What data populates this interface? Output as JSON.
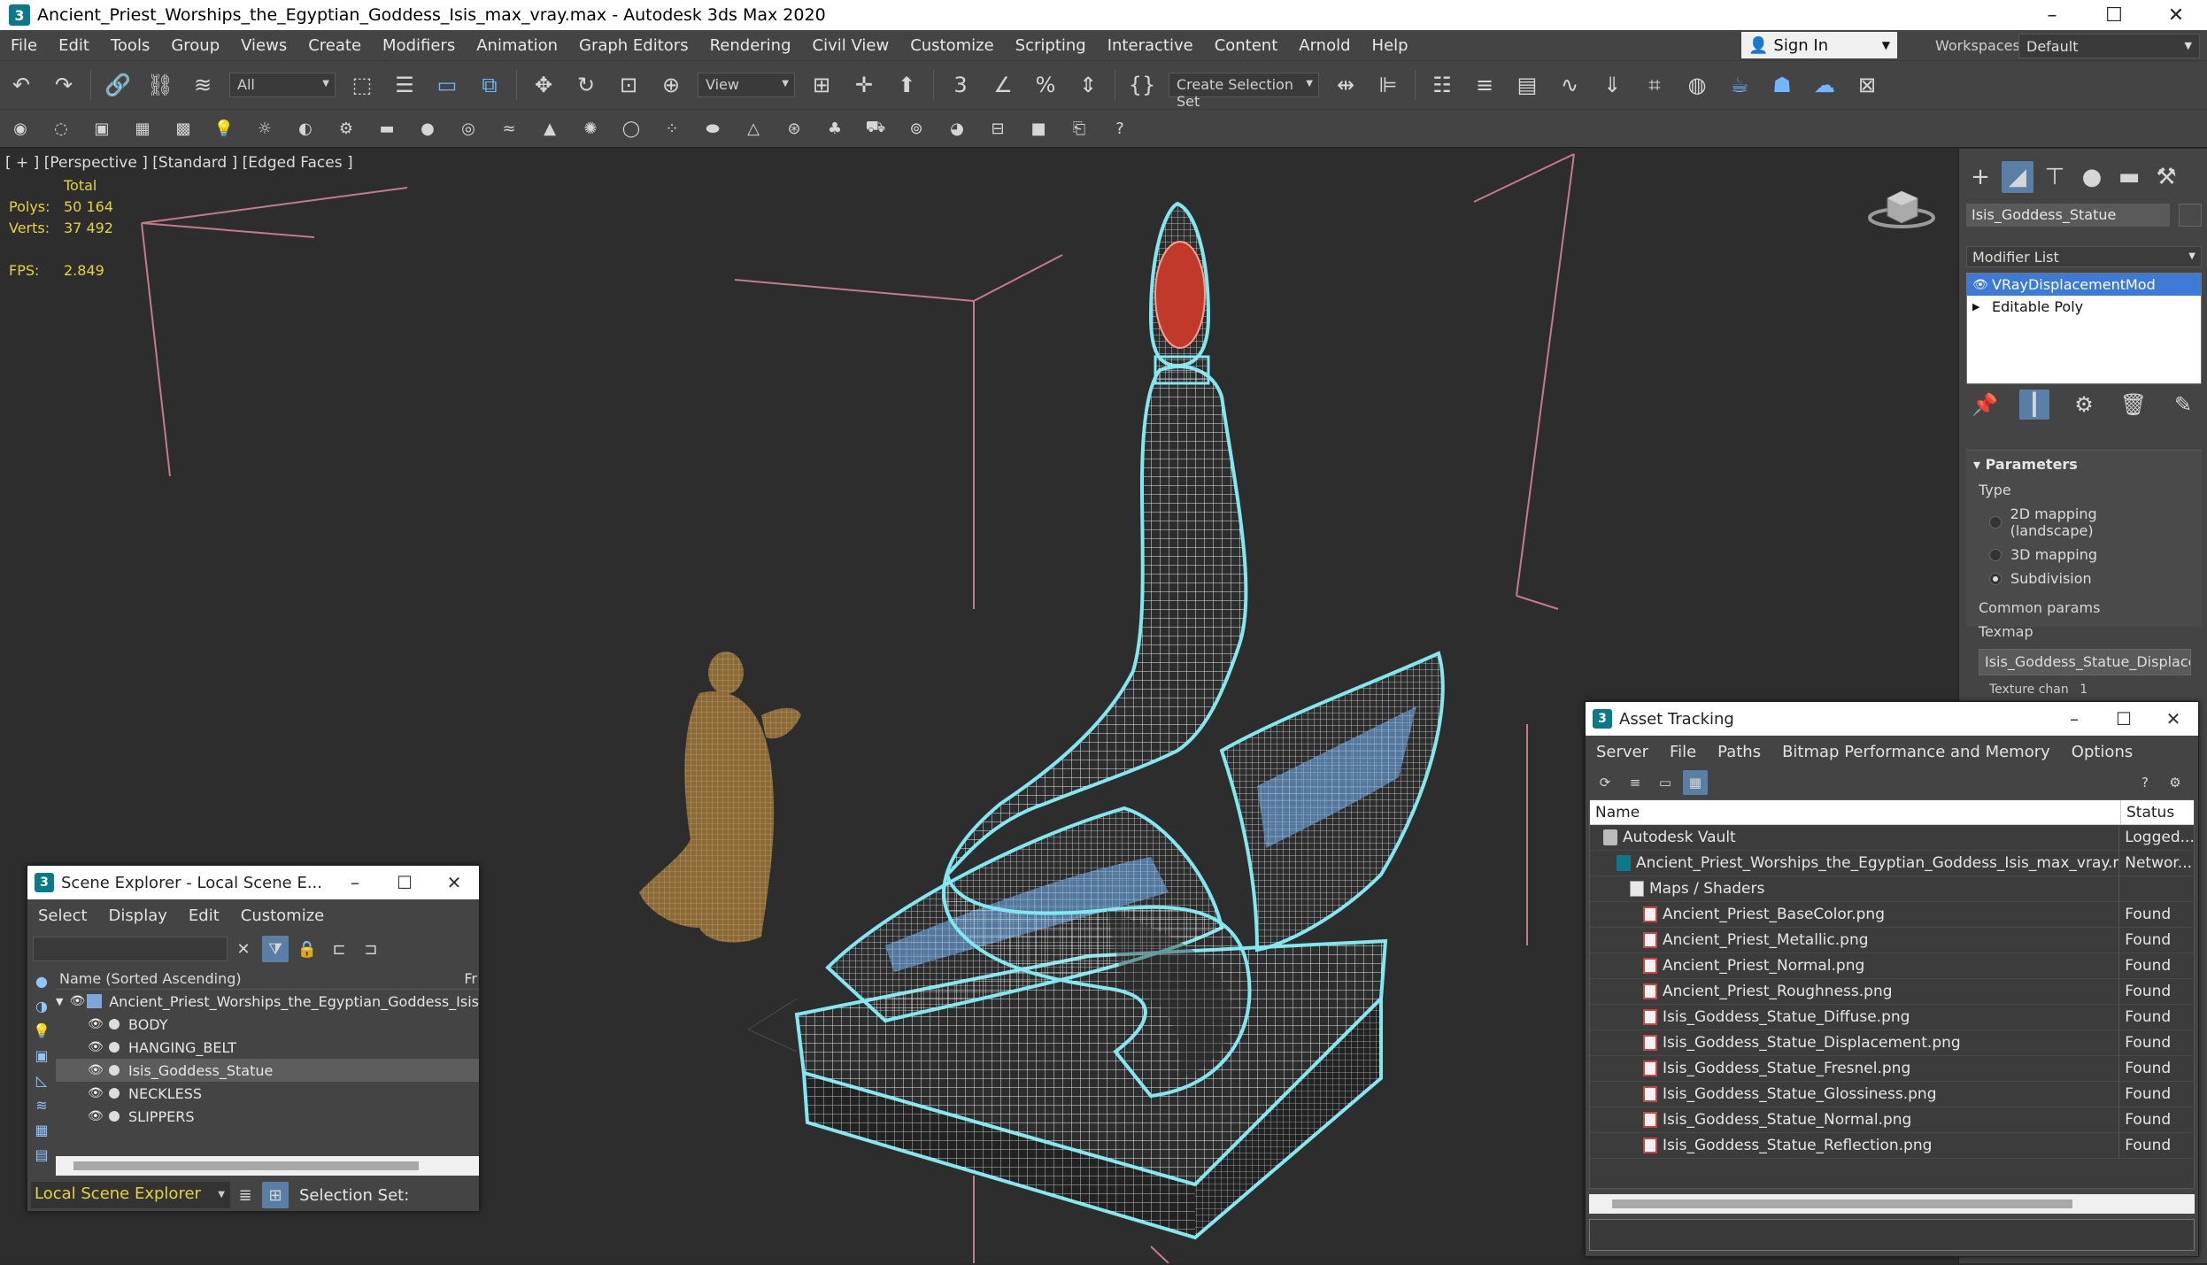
{
  "window": {
    "title": "Ancient_Priest_Worships_the_Egyptian_Goddess_Isis_max_vray.max - Autodesk 3ds Max 2020",
    "app_icon": "3"
  },
  "menu": [
    "File",
    "Edit",
    "Tools",
    "Group",
    "Views",
    "Create",
    "Modifiers",
    "Animation",
    "Graph Editors",
    "Rendering",
    "Civil View",
    "Customize",
    "Scripting",
    "Interactive",
    "Content",
    "Arnold",
    "Help"
  ],
  "signin": {
    "label": "Sign In"
  },
  "workspaces": {
    "label": "Workspaces:",
    "value": "Default"
  },
  "toolbar": {
    "filter_value": "All",
    "refcoord_value": "View",
    "selection_set_placeholder": "Create Selection Set"
  },
  "viewport": {
    "label": "[ + ] [Perspective ] [Standard ] [Edged Faces ]",
    "stats": {
      "total_label": "Total",
      "polys_label": "Polys:",
      "polys_value": "50 164",
      "verts_label": "Verts:",
      "verts_value": "37 492",
      "fps_label": "FPS:",
      "fps_value": "2.849"
    }
  },
  "command_panel": {
    "object_name": "Isis_Goddess_Statue",
    "modifier_list_label": "Modifier List",
    "stack": [
      {
        "label": "VRayDisplacementMod",
        "selected": true
      },
      {
        "label": "Editable Poly",
        "selected": false
      }
    ],
    "params_title": "Parameters",
    "type_label": "Type",
    "type_options": [
      {
        "label": "2D mapping (landscape)",
        "checked": false
      },
      {
        "label": "3D mapping",
        "checked": false
      },
      {
        "label": "Subdivision",
        "checked": true
      }
    ],
    "common_params_label": "Common params",
    "texmap_label": "Texmap",
    "texmap_value": "Isis_Goddess_Statue_Displace",
    "texture_chan_label": "Texture chan",
    "texture_chan_value": "1"
  },
  "scene_explorer": {
    "title": "Scene Explorer - Local Scene E...",
    "menu": [
      "Select",
      "Display",
      "Edit",
      "Customize"
    ],
    "column_header": "Name (Sorted Ascending)",
    "column_header_right": "Fr",
    "root": "Ancient_Priest_Worships_the_Egyptian_Goddess_Isis",
    "items": [
      {
        "label": "BODY",
        "selected": false
      },
      {
        "label": "HANGING_BELT",
        "selected": false
      },
      {
        "label": "Isis_Goddess_Statue",
        "selected": true
      },
      {
        "label": "NECKLESS",
        "selected": false
      },
      {
        "label": "SLIPPERS",
        "selected": false
      }
    ],
    "explorer_selector": "Local Scene Explorer",
    "selection_set_label": "Selection Set:"
  },
  "asset_tracking": {
    "title": "Asset Tracking",
    "menu": [
      "Server",
      "File",
      "Paths",
      "Bitmap Performance and Memory",
      "Options"
    ],
    "columns": {
      "name": "Name",
      "status": "Status"
    },
    "rows": [
      {
        "name": "Autodesk Vault",
        "status": "Logged...",
        "icon": "vault",
        "indent": 1
      },
      {
        "name": "Ancient_Priest_Worships_the_Egyptian_Goddess_Isis_max_vray.max",
        "status": "Networ...",
        "icon": "max",
        "indent": 2
      },
      {
        "name": "Maps / Shaders",
        "status": "",
        "icon": "folder",
        "indent": 3
      },
      {
        "name": "Ancient_Priest_BaseColor.png",
        "status": "Found",
        "icon": "png",
        "indent": 4
      },
      {
        "name": "Ancient_Priest_Metallic.png",
        "status": "Found",
        "icon": "png",
        "indent": 4
      },
      {
        "name": "Ancient_Priest_Normal.png",
        "status": "Found",
        "icon": "png",
        "indent": 4
      },
      {
        "name": "Ancient_Priest_Roughness.png",
        "status": "Found",
        "icon": "png",
        "indent": 4
      },
      {
        "name": "Isis_Goddess_Statue_Diffuse.png",
        "status": "Found",
        "icon": "png",
        "indent": 4
      },
      {
        "name": "Isis_Goddess_Statue_Displacement.png",
        "status": "Found",
        "icon": "png",
        "indent": 4
      },
      {
        "name": "Isis_Goddess_Statue_Fresnel.png",
        "status": "Found",
        "icon": "png",
        "indent": 4
      },
      {
        "name": "Isis_Goddess_Statue_Glossiness.png",
        "status": "Found",
        "icon": "png",
        "indent": 4
      },
      {
        "name": "Isis_Goddess_Statue_Normal.png",
        "status": "Found",
        "icon": "png",
        "indent": 4
      },
      {
        "name": "Isis_Goddess_Statue_Reflection.png",
        "status": "Found",
        "icon": "png",
        "indent": 4
      }
    ]
  },
  "colors": {
    "accent": "#5a7fa6",
    "selection_highlight": "#3d79d6",
    "stats_text": "#e6d33a",
    "wire_cyan": "#7fe8f0",
    "bbox_pink": "#c77a8a"
  }
}
